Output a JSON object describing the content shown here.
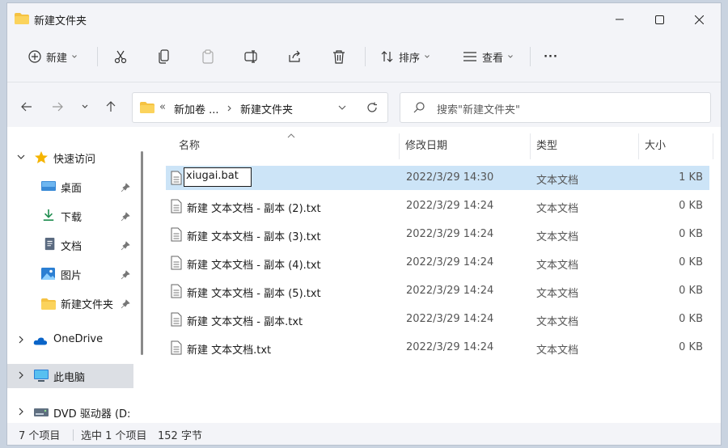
{
  "window": {
    "title": "新建文件夹"
  },
  "toolbar": {
    "new_label": "新建",
    "sort_label": "排序",
    "view_label": "查看",
    "more_label": "···"
  },
  "address": {
    "overflow": "«",
    "segments": [
      "新加卷 ...",
      "新建文件夹"
    ]
  },
  "search": {
    "placeholder": "搜索\"新建文件夹\""
  },
  "sidebar": {
    "items": [
      {
        "label": "快速访问"
      },
      {
        "label": "桌面"
      },
      {
        "label": "下载"
      },
      {
        "label": "文档"
      },
      {
        "label": "图片"
      },
      {
        "label": "新建文件夹"
      },
      {
        "label": "OneDrive"
      },
      {
        "label": "此电脑"
      },
      {
        "label": "DVD 驱动器 (D:"
      }
    ]
  },
  "columns": {
    "name": "名称",
    "date": "修改日期",
    "type": "类型",
    "size": "大小"
  },
  "files": [
    {
      "name": "xiugai.bat",
      "date": "2022/3/29 14:30",
      "type": "文本文档",
      "size": "1 KB"
    },
    {
      "name": "新建 文本文档 - 副本 (2).txt",
      "date": "2022/3/29 14:24",
      "type": "文本文档",
      "size": "0 KB"
    },
    {
      "name": "新建 文本文档 - 副本 (3).txt",
      "date": "2022/3/29 14:24",
      "type": "文本文档",
      "size": "0 KB"
    },
    {
      "name": "新建 文本文档 - 副本 (4).txt",
      "date": "2022/3/29 14:24",
      "type": "文本文档",
      "size": "0 KB"
    },
    {
      "name": "新建 文本文档 - 副本 (5).txt",
      "date": "2022/3/29 14:24",
      "type": "文本文档",
      "size": "0 KB"
    },
    {
      "name": "新建 文本文档 - 副本.txt",
      "date": "2022/3/29 14:24",
      "type": "文本文档",
      "size": "0 KB"
    },
    {
      "name": "新建 文本文档.txt",
      "date": "2022/3/29 14:24",
      "type": "文本文档",
      "size": "0 KB"
    }
  ],
  "status": {
    "count": "7 个项目",
    "selected": "选中 1 个项目",
    "size": "152 字节"
  },
  "colors": {
    "accent": "#0067c0",
    "selection": "#cce4f7",
    "folder": "#f5c242"
  }
}
